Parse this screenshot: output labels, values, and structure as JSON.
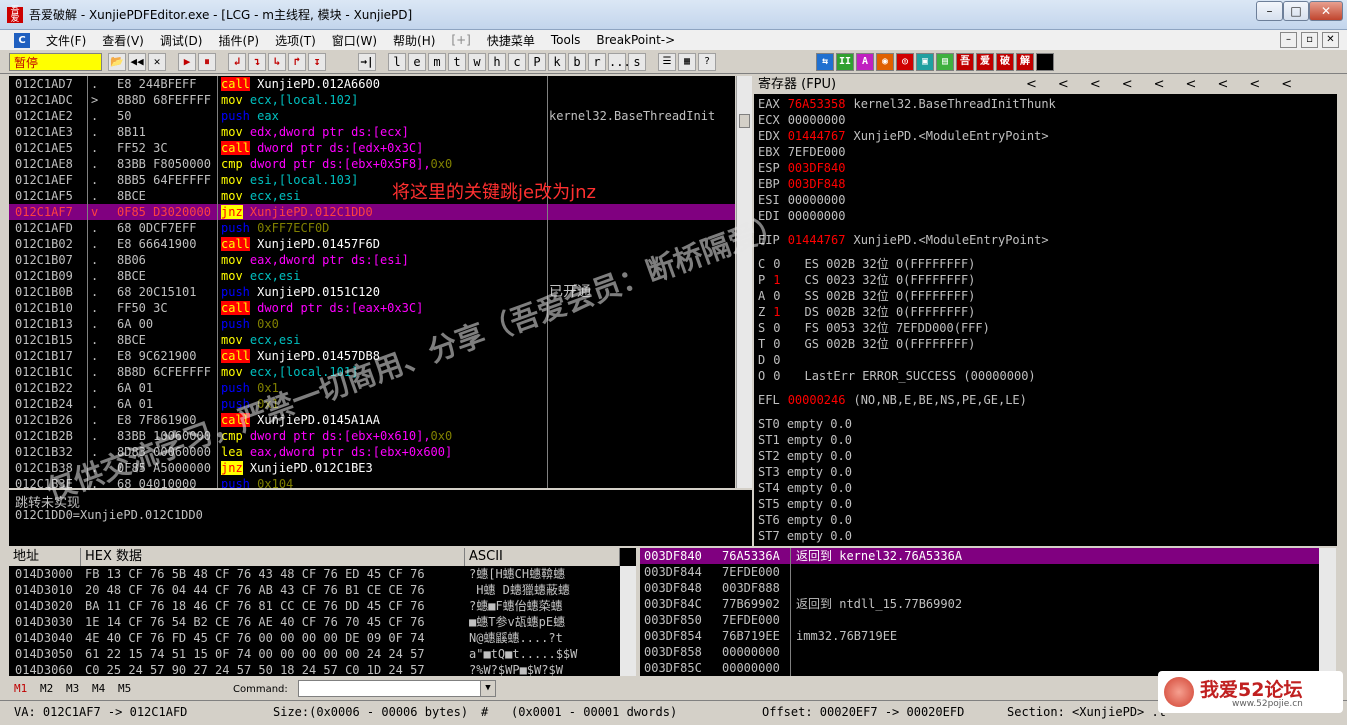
{
  "window": {
    "title": "吾爱破解 - XunjiePDFEditor.exe - [LCG - m主线程, 模块 - XunjiePD]",
    "minimize": "–",
    "maximize": "□",
    "close": "✕",
    "app_icon_text": "吾爱"
  },
  "menu": {
    "icon": "C",
    "items": [
      "文件(F)",
      "查看(V)",
      "调试(D)",
      "插件(P)",
      "选项(T)",
      "窗口(W)",
      "帮助(H)",
      "[+]",
      "快捷菜单",
      "Tools",
      "BreakPoint->"
    ],
    "mdi": [
      "–",
      "▫",
      "✕"
    ]
  },
  "toolbar": {
    "status": "暂停",
    "buttons": [
      "📂",
      "◀◀",
      "✕",
      "▶",
      "⏸",
      "↲",
      "↴",
      "↳",
      "↱",
      "↧",
      "→|"
    ],
    "letters": [
      "l",
      "e",
      "m",
      "t",
      "w",
      "h",
      "c",
      "P",
      "k",
      "b",
      "r",
      "...",
      "s"
    ],
    "right_icons": [
      "⇆",
      "II",
      "A",
      "◉",
      "◎",
      "▣",
      "吾",
      "爱",
      "破",
      "解"
    ]
  },
  "cpu": {
    "rows": [
      {
        "addr": "012C1AD7",
        "mark": ".",
        "hex": "E8 244BFEFF",
        "op": "call",
        "args": [
          {
            "t": "XunjiePD.012A6600",
            "c": "wh"
          }
        ],
        "cmt": ""
      },
      {
        "addr": "012C1ADC",
        "mark": ">",
        "hex": "8B8D 68FEFFFF",
        "op": "mov",
        "args": [
          {
            "t": "ecx,[local.102]",
            "c": "cyan"
          }
        ],
        "cmt": ""
      },
      {
        "addr": "012C1AE2",
        "mark": ".",
        "hex": "50",
        "op": "push",
        "args": [
          {
            "t": "eax",
            "c": "cyan"
          }
        ],
        "cmt": "kernel32.BaseThreadInit"
      },
      {
        "addr": "012C1AE3",
        "mark": ".",
        "hex": "8B11",
        "op": "mov",
        "args": [
          {
            "t": "edx,dword ptr ds:[ecx]",
            "c": "mag"
          }
        ],
        "cmt": ""
      },
      {
        "addr": "012C1AE5",
        "mark": ".",
        "hex": "FF52 3C",
        "op": "call",
        "args": [
          {
            "t": "dword ptr ds:[edx+0x3C]",
            "c": "mag"
          }
        ],
        "cmt": ""
      },
      {
        "addr": "012C1AE8",
        "mark": ".",
        "hex": "83BB F8050000",
        "op": "cmp",
        "args": [
          {
            "t": "dword ptr ds:[ebx+0x5F8],",
            "c": "mag"
          },
          {
            "t": "0x0",
            "c": "ol"
          }
        ],
        "cmt": ""
      },
      {
        "addr": "012C1AEF",
        "mark": ".",
        "hex": "8BB5 64FEFFFF",
        "op": "mov",
        "args": [
          {
            "t": "esi,[local.103]",
            "c": "cyan"
          }
        ],
        "cmt": ""
      },
      {
        "addr": "012C1AF5",
        "mark": ".",
        "hex": "8BCE",
        "op": "mov",
        "args": [
          {
            "t": "ecx,esi",
            "c": "cyan"
          }
        ],
        "cmt": ""
      },
      {
        "addr": "012C1AF7",
        "mark": "v",
        "hex": "0F85 D3020000",
        "op": "jnz",
        "args": [
          {
            "t": "XunjiePD.012C1DD0",
            "c": "wh"
          }
        ],
        "cmt": "",
        "sel": true
      },
      {
        "addr": "012C1AFD",
        "mark": ".",
        "hex": "68 0DCF7EFF",
        "op": "push",
        "args": [
          {
            "t": "0xFF7ECF0D",
            "c": "ol"
          }
        ],
        "cmt": ""
      },
      {
        "addr": "012C1B02",
        "mark": ".",
        "hex": "E8 66641900",
        "op": "call",
        "args": [
          {
            "t": "XunjiePD.01457F6D",
            "c": "wh"
          }
        ],
        "cmt": ""
      },
      {
        "addr": "012C1B07",
        "mark": ".",
        "hex": "8B06",
        "op": "mov",
        "args": [
          {
            "t": "eax,dword ptr ds:[esi]",
            "c": "mag"
          }
        ],
        "cmt": ""
      },
      {
        "addr": "012C1B09",
        "mark": ".",
        "hex": "8BCE",
        "op": "mov",
        "args": [
          {
            "t": "ecx,esi",
            "c": "cyan"
          }
        ],
        "cmt": ""
      },
      {
        "addr": "012C1B0B",
        "mark": ".",
        "hex": "68 20C15101",
        "op": "push",
        "args": [
          {
            "t": "XunjiePD.0151C120",
            "c": "wh"
          }
        ],
        "cmt": "已开通"
      },
      {
        "addr": "012C1B10",
        "mark": ".",
        "hex": "FF50 3C",
        "op": "call",
        "args": [
          {
            "t": "dword ptr ds:[eax+0x3C]",
            "c": "mag"
          }
        ],
        "cmt": ""
      },
      {
        "addr": "012C1B13",
        "mark": ".",
        "hex": "6A 00",
        "op": "push",
        "args": [
          {
            "t": "0x0",
            "c": "ol"
          }
        ],
        "cmt": ""
      },
      {
        "addr": "012C1B15",
        "mark": ".",
        "hex": "8BCE",
        "op": "mov",
        "args": [
          {
            "t": "ecx,esi",
            "c": "cyan"
          }
        ],
        "cmt": ""
      },
      {
        "addr": "012C1B17",
        "mark": ".",
        "hex": "E8 9C621900",
        "op": "call",
        "args": [
          {
            "t": "XunjiePD.01457DB8",
            "c": "wh"
          }
        ],
        "cmt": ""
      },
      {
        "addr": "012C1B1C",
        "mark": ".",
        "hex": "8B8D 6CFEFFFF",
        "op": "mov",
        "args": [
          {
            "t": "ecx,[local.101]",
            "c": "cyan"
          }
        ],
        "cmt": ""
      },
      {
        "addr": "012C1B22",
        "mark": ".",
        "hex": "6A 01",
        "op": "push",
        "args": [
          {
            "t": "0x1",
            "c": "ol"
          }
        ],
        "cmt": ""
      },
      {
        "addr": "012C1B24",
        "mark": ".",
        "hex": "6A 01",
        "op": "push",
        "args": [
          {
            "t": "0x1",
            "c": "ol"
          }
        ],
        "cmt": ""
      },
      {
        "addr": "012C1B26",
        "mark": ".",
        "hex": "E8 7F861900",
        "op": "call",
        "args": [
          {
            "t": "XunjiePD.0145A1AA",
            "c": "wh"
          }
        ],
        "cmt": ""
      },
      {
        "addr": "012C1B2B",
        "mark": ".",
        "hex": "83BB 10060000",
        "op": "cmp",
        "args": [
          {
            "t": "dword ptr ds:[ebx+0x610],",
            "c": "mag"
          },
          {
            "t": "0x0",
            "c": "ol"
          }
        ],
        "cmt": ""
      },
      {
        "addr": "012C1B32",
        "mark": ".",
        "hex": "8D83 00060000",
        "op": "lea",
        "args": [
          {
            "t": "eax,dword ptr ds:[ebx+0x600]",
            "c": "mag"
          }
        ],
        "cmt": ""
      },
      {
        "addr": "012C1B38",
        "mark": ".",
        "hex": "0F85 A5000000",
        "op": "jnz",
        "args": [
          {
            "t": "XunjiePD.012C1BE3",
            "c": "wh"
          }
        ],
        "cmt": ""
      },
      {
        "addr": "012C1B3E",
        "mark": ".",
        "hex": "68 04010000",
        "op": "push",
        "args": [
          {
            "t": "0x104",
            "c": "ol"
          }
        ],
        "cmt": ""
      }
    ],
    "annotation": "将这里的关键跳je改为jnz"
  },
  "info": {
    "line1": "跳转未实现",
    "line2": "012C1DD0=XunjiePD.012C1DD0"
  },
  "registers": {
    "header": "寄存器 (FPU)",
    "arrows": [
      "<",
      "<",
      "<",
      "<",
      "<",
      "<",
      "<",
      "<",
      "<"
    ],
    "gp": [
      {
        "name": "EAX",
        "val": "76A53358",
        "chg": true,
        "note": "kernel32.BaseThreadInitThunk"
      },
      {
        "name": "ECX",
        "val": "00000000",
        "chg": false,
        "note": ""
      },
      {
        "name": "EDX",
        "val": "01444767",
        "chg": true,
        "note": "XunjiePD.<ModuleEntryPoint>"
      },
      {
        "name": "EBX",
        "val": "7EFDE000",
        "chg": false,
        "note": ""
      },
      {
        "name": "ESP",
        "val": "003DF840",
        "chg": true,
        "note": ""
      },
      {
        "name": "EBP",
        "val": "003DF848",
        "chg": true,
        "note": ""
      },
      {
        "name": "ESI",
        "val": "00000000",
        "chg": false,
        "note": ""
      },
      {
        "name": "EDI",
        "val": "00000000",
        "chg": false,
        "note": ""
      }
    ],
    "eip": {
      "name": "EIP",
      "val": "01444767",
      "note": "XunjiePD.<ModuleEntryPoint>"
    },
    "flags": [
      {
        "f": "C",
        "v": "0",
        "chg": false,
        "seg": "ES 002B 32位 0(FFFFFFFF)"
      },
      {
        "f": "P",
        "v": "1",
        "chg": true,
        "seg": "CS 0023 32位 0(FFFFFFFF)"
      },
      {
        "f": "A",
        "v": "0",
        "chg": false,
        "seg": "SS 002B 32位 0(FFFFFFFF)"
      },
      {
        "f": "Z",
        "v": "1",
        "chg": true,
        "seg": "DS 002B 32位 0(FFFFFFFF)"
      },
      {
        "f": "S",
        "v": "0",
        "chg": false,
        "seg": "FS 0053 32位 7EFDD000(FFF)"
      },
      {
        "f": "T",
        "v": "0",
        "chg": false,
        "seg": "GS 002B 32位 0(FFFFFFFF)"
      },
      {
        "f": "D",
        "v": "0",
        "chg": false,
        "seg": ""
      },
      {
        "f": "O",
        "v": "0",
        "chg": false,
        "seg": "LastErr ERROR_SUCCESS (00000000)"
      }
    ],
    "efl": {
      "name": "EFL",
      "val": "00000246",
      "note": "(NO,NB,E,BE,NS,PE,GE,LE)"
    },
    "fpu": [
      "ST0 empty 0.0",
      "ST1 empty 0.0",
      "ST2 empty 0.0",
      "ST3 empty 0.0",
      "ST4 empty 0.0",
      "ST5 empty 0.0",
      "ST6 empty 0.0",
      "ST7 empty 0.0"
    ]
  },
  "dump": {
    "headers": {
      "addr": "地址",
      "hex": "HEX 数据",
      "ascii": "ASCII"
    },
    "rows": [
      {
        "addr": "014D3000",
        "hex": "FB 13 CF 76 5B 48 CF 76 43 48 CF 76 ED 45 CF 76",
        "ascii": "?蟪[H蟪CH蟪鞥蟪"
      },
      {
        "addr": "014D3010",
        "hex": "20 48 CF 76 04 44 CF 76 AB 43 CF 76 B1 CE CE 76",
        "ascii": " H蟪 D蟪獵蟪蔽蟪"
      },
      {
        "addr": "014D3020",
        "hex": "BA 11 CF 76 18 46 CF 76 81 CC CE 76 DD 45 CF 76",
        "ascii": "?蟪■F蟪佁蟪蒅蟪"
      },
      {
        "addr": "014D3030",
        "hex": "1E 14 CF 76 54 B2 CE 76 AE 40 CF 76 70 45 CF 76",
        "ascii": "■蟪T参v瓳蟪pE蟪"
      },
      {
        "addr": "014D3040",
        "hex": "4E 40 CF 76 FD 45 CF 76 00 00 00 00 DE 09 0F 74",
        "ascii": "N@蟪鼷蟪....?t"
      },
      {
        "addr": "014D3050",
        "hex": "61 22 15 74 51 15 0F 74 00 00 00 00 00 24 24 57",
        "ascii": "a\"■tQ■t.....$$W"
      },
      {
        "addr": "014D3060",
        "hex": "C0 25 24 57 90 27 24 57 50 18 24 57 C0 1D 24 57",
        "ascii": "?%W?$WP■$W?$W"
      }
    ]
  },
  "stack": {
    "rows": [
      {
        "addr": "003DF840",
        "val": "76A5336A",
        "note": "返回到 kernel32.76A5336A",
        "sel": true
      },
      {
        "addr": "003DF844",
        "val": "7EFDE000",
        "note": ""
      },
      {
        "addr": "003DF848",
        "val": "003DF888",
        "note": ""
      },
      {
        "addr": "003DF84C",
        "val": "77B69902",
        "note": "返回到 ntdll_15.77B69902"
      },
      {
        "addr": "003DF850",
        "val": "7EFDE000",
        "note": ""
      },
      {
        "addr": "003DF854",
        "val": "76B719EE",
        "note": "imm32.76B719EE"
      },
      {
        "addr": "003DF858",
        "val": "00000000",
        "note": ""
      },
      {
        "addr": "003DF85C",
        "val": "00000000",
        "note": ""
      }
    ]
  },
  "cmdbar": {
    "tabs": [
      "M1",
      "M2",
      "M3",
      "M4",
      "M5"
    ],
    "label": "Command:"
  },
  "statusbar": {
    "va": "VA: 012C1AF7 -> 012C1AFD",
    "size": "Size:(0x0006 - 00006 bytes)",
    "hash": "#",
    "dwords": "(0x0001 - 00001 dwords)",
    "offset": "Offset: 00020EF7 -> 00020EFD",
    "section": "Section: <XunjiePD> .t"
  },
  "watermark": {
    "text": "仅供交流学习，严禁一切商用、分享（吾爱会员：断桥隔爱）",
    "logo": "我爱52论坛",
    "logo_url": "www.52pojie.cn"
  }
}
